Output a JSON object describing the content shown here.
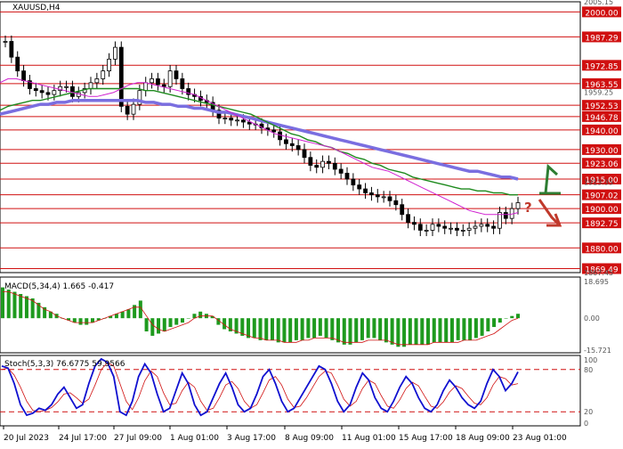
{
  "chart_data": {
    "type": "line",
    "symbol_label": "XAUUSD,H4",
    "x_tick_labels": [
      "20 Jul 2023",
      "24 Jul 17:00",
      "27 Jul 09:00",
      "1 Aug 01:00",
      "3 Aug 17:00",
      "8 Aug 09:00",
      "11 Aug 01:00",
      "15 Aug 17:00",
      "18 Aug 09:00",
      "23 Aug 01:00"
    ],
    "price_panel": {
      "ylim": [
        1867.45,
        2005.15
      ],
      "axis_ticks": [
        "2005.15",
        "1959.25",
        "1913.35",
        "1867.45"
      ],
      "levels": [
        {
          "label": "2000.00",
          "value": 2000.0
        },
        {
          "label": "1987.29",
          "value": 1987.29
        },
        {
          "label": "1972.85",
          "value": 1972.85
        },
        {
          "label": "1963.55",
          "value": 1963.55
        },
        {
          "label": "1952.53",
          "value": 1952.53
        },
        {
          "label": "1946.78",
          "value": 1946.78
        },
        {
          "label": "1940.00",
          "value": 1940.0
        },
        {
          "label": "1930.00",
          "value": 1930.0
        },
        {
          "label": "1923.06",
          "value": 1923.06
        },
        {
          "label": "1915.00",
          "value": 1915.0
        },
        {
          "label": "1907.02",
          "value": 1907.02
        },
        {
          "label": "1900.00",
          "value": 1900.0
        },
        {
          "label": "1892.75",
          "value": 1892.75
        },
        {
          "label": "1880.00",
          "value": 1880.0
        },
        {
          "label": "1869.49",
          "value": 1869.49
        }
      ],
      "close_series": [
        1985,
        1977,
        1970,
        1965,
        1961,
        1960,
        1959,
        1958,
        1960,
        1962,
        1962,
        1957,
        1959,
        1961,
        1964,
        1966,
        1970,
        1976,
        1982,
        1952,
        1948,
        1953,
        1960,
        1964,
        1966,
        1963,
        1962,
        1970,
        1966,
        1961,
        1958,
        1957,
        1955,
        1954,
        1950,
        1946,
        1946,
        1945,
        1945,
        1944,
        1943,
        1943,
        1941,
        1940,
        1939,
        1935,
        1933,
        1932,
        1930,
        1926,
        1922,
        1921,
        1924,
        1923,
        1920,
        1918,
        1915,
        1912,
        1910,
        1908,
        1907,
        1906,
        1906,
        1904,
        1902,
        1897,
        1893,
        1892,
        1889,
        1889,
        1892,
        1891,
        1890,
        1890,
        1889,
        1889,
        1890,
        1891,
        1892,
        1891,
        1890,
        1898,
        1895,
        1900,
        1903
      ],
      "sma_magenta": [
        1964,
        1966,
        1966,
        1965,
        1964,
        1963,
        1962,
        1961,
        1960,
        1959,
        1958,
        1957,
        1957,
        1958,
        1959,
        1961,
        1963,
        1964,
        1964,
        1963,
        1962,
        1961,
        1960,
        1959,
        1958,
        1956,
        1954,
        1952,
        1950,
        1948,
        1946,
        1944,
        1942,
        1940,
        1938,
        1937,
        1936,
        1935,
        1934,
        1933,
        1932,
        1931,
        1929,
        1927,
        1925,
        1923,
        1921,
        1920,
        1919,
        1917,
        1915,
        1913,
        1911,
        1909,
        1907,
        1905,
        1903,
        1901,
        1899,
        1898,
        1897,
        1897,
        1897,
        1897,
        1898
      ],
      "sma_green": [
        1950,
        1952,
        1953,
        1954,
        1955,
        1955,
        1956,
        1957,
        1958,
        1959,
        1960,
        1961,
        1961,
        1961,
        1961,
        1961,
        1961,
        1961,
        1960,
        1960,
        1959,
        1958,
        1957,
        1956,
        1955,
        1954,
        1953,
        1952,
        1951,
        1950,
        1949,
        1948,
        1946,
        1944,
        1942,
        1940,
        1938,
        1937,
        1935,
        1934,
        1932,
        1931,
        1929,
        1928,
        1926,
        1925,
        1923,
        1922,
        1920,
        1919,
        1918,
        1916,
        1915,
        1914,
        1913,
        1912,
        1911,
        1910,
        1910,
        1909,
        1909,
        1908,
        1908,
        1907,
        1907
      ],
      "sma_blue": [
        1948,
        1949,
        1950,
        1951,
        1952,
        1953,
        1953,
        1954,
        1954,
        1955,
        1955,
        1955,
        1955,
        1955,
        1955,
        1955,
        1955,
        1955,
        1954,
        1954,
        1953,
        1953,
        1952,
        1952,
        1951,
        1951,
        1950,
        1949,
        1949,
        1948,
        1947,
        1946,
        1945,
        1944,
        1943,
        1942,
        1941,
        1940,
        1939,
        1938,
        1937,
        1936,
        1935,
        1934,
        1933,
        1932,
        1931,
        1930,
        1929,
        1928,
        1927,
        1926,
        1925,
        1924,
        1923,
        1922,
        1921,
        1920,
        1919,
        1919,
        1918,
        1917,
        1916,
        1916,
        1915
      ],
      "annotation": "?"
    },
    "macd_panel": {
      "label": "MACD(5,34,4) 1.665 -0.417",
      "axis_ticks": [
        "18.695",
        "0.00",
        "-15.721"
      ],
      "ylim": [
        -15.721,
        18.695
      ],
      "histogram": [
        14,
        13,
        12,
        11,
        10,
        9,
        7,
        5,
        3,
        2,
        0,
        -1,
        -2,
        -3,
        -3,
        -2,
        -1,
        0,
        1,
        2,
        3,
        4,
        6,
        8,
        -6,
        -8,
        -7,
        -6,
        -4,
        -3,
        -2,
        0,
        2,
        3,
        2,
        1,
        -3,
        -5,
        -6,
        -7,
        -8,
        -9,
        -9,
        -10,
        -10,
        -10,
        -11,
        -11,
        -11,
        -10,
        -10,
        -9,
        -9,
        -8,
        -9,
        -10,
        -11,
        -12,
        -12,
        -11,
        -10,
        -9,
        -9,
        -10,
        -11,
        -12,
        -13,
        -13,
        -12,
        -12,
        -12,
        -12,
        -11,
        -11,
        -11,
        -11,
        -10,
        -10,
        -10,
        -9,
        -8,
        -6,
        -4,
        -2,
        0,
        1,
        2
      ],
      "signal": [
        12,
        12,
        11,
        10,
        9,
        8,
        6,
        4,
        3,
        1,
        0,
        -1,
        -2,
        -2,
        -2,
        -2,
        -1,
        0,
        1,
        2,
        3,
        4,
        5,
        5,
        1,
        -3,
        -5,
        -6,
        -5,
        -4,
        -3,
        -2,
        0,
        1,
        1,
        1,
        -1,
        -3,
        -5,
        -6,
        -7,
        -8,
        -9,
        -9,
        -10,
        -10,
        -10,
        -11,
        -11,
        -11,
        -10,
        -10,
        -9,
        -9,
        -9,
        -9,
        -10,
        -11,
        -11,
        -11,
        -11,
        -10,
        -10,
        -10,
        -10,
        -11,
        -12,
        -12,
        -12,
        -12,
        -12,
        -12,
        -11,
        -11,
        -11,
        -11,
        -11,
        -10,
        -10,
        -10,
        -9,
        -8,
        -7,
        -5,
        -3,
        -1,
        0
      ]
    },
    "stoch_panel": {
      "label": "Stoch(5,3,3) 76.6775 59.9566",
      "axis_ticks": [
        "100",
        "80",
        "20",
        "0"
      ],
      "ylim": [
        0,
        100
      ],
      "levels": [
        80,
        20
      ],
      "k": [
        85,
        82,
        60,
        30,
        15,
        18,
        25,
        22,
        30,
        45,
        55,
        40,
        25,
        30,
        60,
        85,
        95,
        90,
        70,
        20,
        15,
        35,
        70,
        88,
        75,
        45,
        20,
        25,
        50,
        75,
        60,
        30,
        15,
        20,
        40,
        60,
        75,
        55,
        30,
        20,
        25,
        45,
        70,
        80,
        60,
        35,
        20,
        25,
        40,
        55,
        70,
        85,
        80,
        60,
        35,
        20,
        30,
        55,
        75,
        65,
        40,
        25,
        20,
        35,
        55,
        70,
        60,
        40,
        25,
        20,
        30,
        50,
        65,
        55,
        40,
        30,
        25,
        35,
        60,
        80,
        70,
        50,
        60,
        76.6775
      ],
      "d": [
        80,
        82,
        72,
        55,
        35,
        22,
        20,
        22,
        26,
        34,
        45,
        47,
        40,
        32,
        38,
        58,
        80,
        90,
        85,
        60,
        35,
        23,
        40,
        64,
        78,
        70,
        47,
        30,
        32,
        50,
        62,
        55,
        35,
        22,
        25,
        40,
        58,
        63,
        53,
        35,
        25,
        30,
        47,
        65,
        70,
        58,
        38,
        26,
        28,
        40,
        55,
        70,
        78,
        75,
        58,
        38,
        28,
        35,
        53,
        65,
        60,
        43,
        28,
        25,
        37,
        53,
        62,
        57,
        42,
        28,
        25,
        34,
        48,
        57,
        53,
        42,
        32,
        30,
        40,
        58,
        70,
        67,
        58,
        59.9566
      ]
    }
  }
}
